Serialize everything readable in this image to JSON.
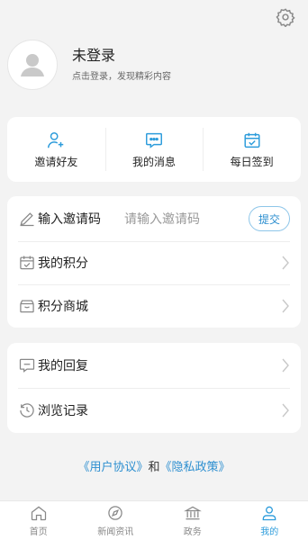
{
  "profile": {
    "name": "未登录",
    "subtitle": "点击登录，发现精彩内容"
  },
  "quick_actions": [
    {
      "label": "邀请好友",
      "icon": "add-user-icon"
    },
    {
      "label": "我的消息",
      "icon": "chat-bubble-icon"
    },
    {
      "label": "每日签到",
      "icon": "calendar-check-icon"
    }
  ],
  "invite": {
    "label": "输入邀请码",
    "placeholder": "请输入邀请码",
    "submit_label": "提交",
    "icon": "pencil-icon"
  },
  "list1": [
    {
      "label": "我的积分",
      "icon": "calendar-check-icon"
    },
    {
      "label": "积分商城",
      "icon": "gift-box-icon"
    }
  ],
  "list2": [
    {
      "label": "我的回复",
      "icon": "comment-icon"
    },
    {
      "label": "浏览记录",
      "icon": "history-clock-icon"
    }
  ],
  "agreement": {
    "user_agreement": "《用户协议》",
    "and": "和",
    "privacy_policy": "《隐私政策》"
  },
  "tabbar": [
    {
      "label": "首页",
      "icon": "home-icon",
      "active": false
    },
    {
      "label": "新闻资讯",
      "icon": "news-icon",
      "active": false
    },
    {
      "label": "政务",
      "icon": "government-icon",
      "active": false
    },
    {
      "label": "我的",
      "icon": "user-icon",
      "active": true
    }
  ],
  "colors": {
    "accent": "#2d9cdb",
    "background": "#f3f3f3",
    "link": "#2d8fd0"
  }
}
